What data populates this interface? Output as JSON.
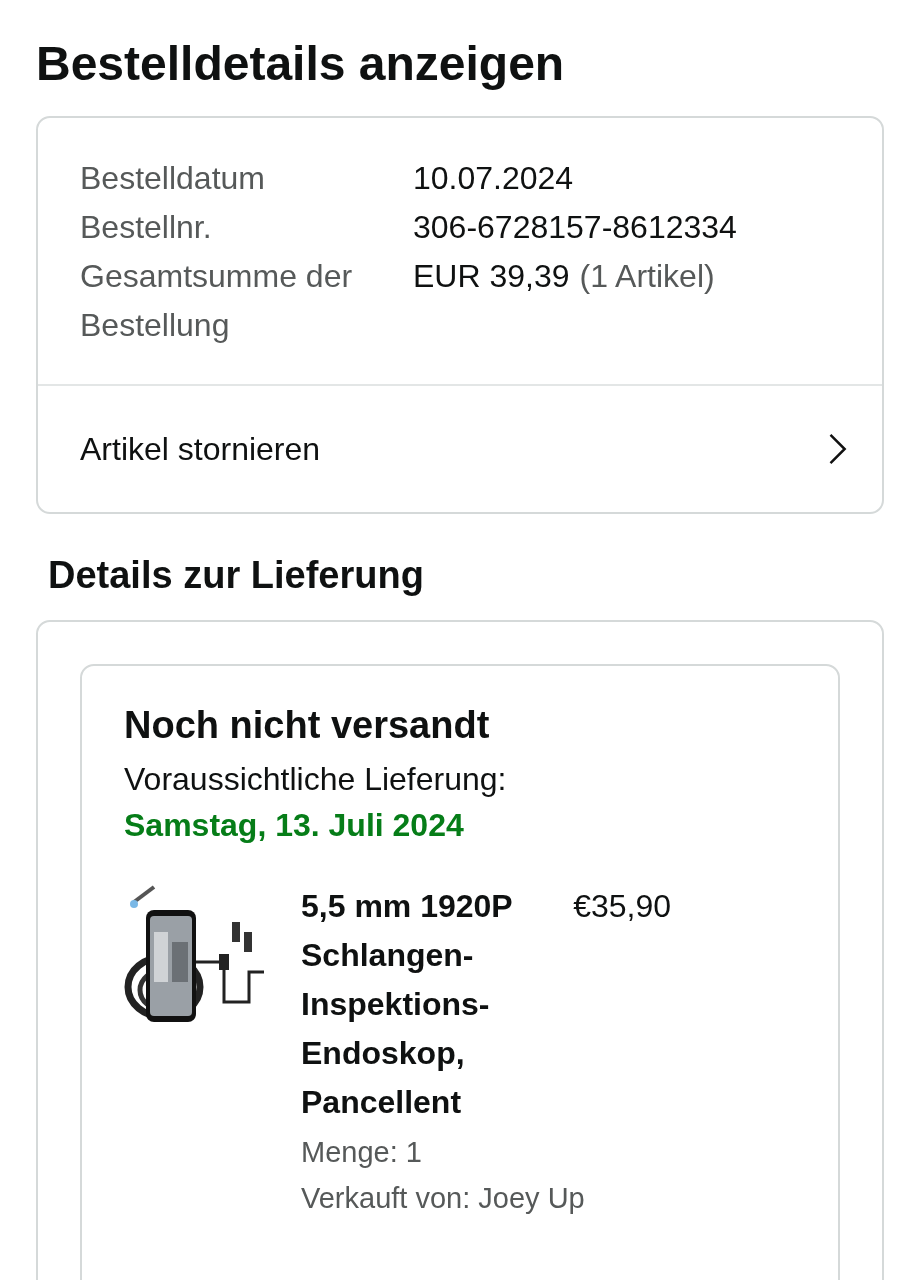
{
  "page_title": "Bestelldetails anzeigen",
  "order_summary": {
    "rows": [
      {
        "label": "Bestelldatum",
        "value": "10.07.2024"
      },
      {
        "label": "Bestellnr.",
        "value": "306-6728157-8612334"
      },
      {
        "label": "Gesamtsumme der Bestellung",
        "value": "EUR 39,39",
        "note": "(1 Artikel)"
      }
    ],
    "action": "Artikel stornieren"
  },
  "delivery": {
    "heading": "Details zur Lieferung",
    "status": "Noch nicht versandt",
    "eta_label": "Voraussichtliche Lieferung:",
    "eta_date": "Samstag, 13. Juli 2024",
    "items": [
      {
        "title": "5,5 mm 1920P Schlangen-Inspektions-Endoskop, Pancellent",
        "price": "€35,90",
        "quantity": "Menge: 1",
        "seller": "Verkauft von: Joey Up"
      }
    ]
  }
}
